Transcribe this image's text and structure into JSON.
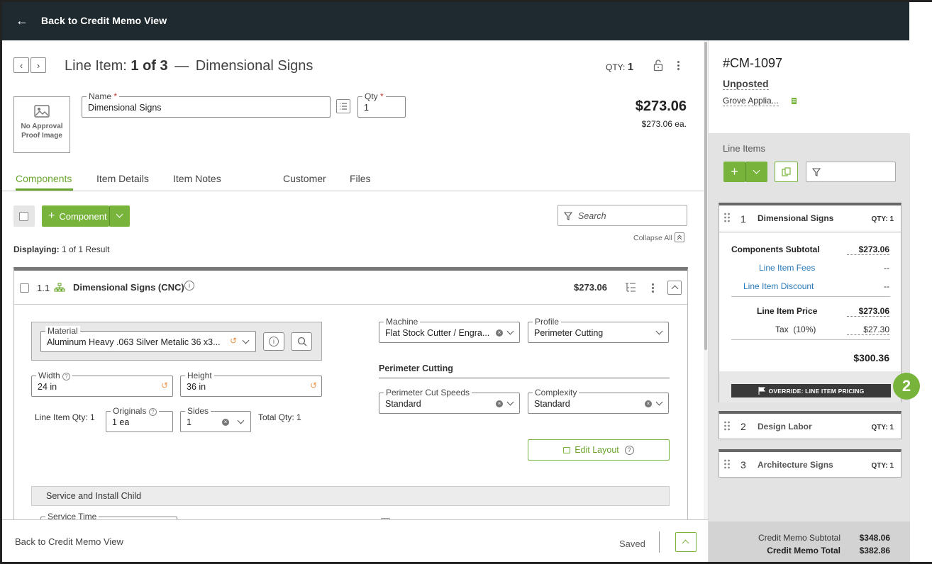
{
  "header": {
    "back_label": "Back to Credit Memo View"
  },
  "line_item": {
    "label": "Line Item:",
    "position": "1 of 3",
    "dash": "—",
    "name": "Dimensional Signs",
    "qty_label": "QTY:",
    "qty_value": "1",
    "price": "$273.06",
    "price_each": "$273.06 ea.",
    "image_placeholder": "No Approval Proof Image"
  },
  "fields": {
    "name_label": "Name",
    "name_value": "Dimensional Signs",
    "qty_label": "Qty",
    "qty_value": "1",
    "required_mark": "*"
  },
  "tabs": [
    "Components",
    "Item Details",
    "Item Notes",
    "Customer",
    "Files"
  ],
  "toolbar": {
    "add_component": "Component",
    "search_placeholder": "Search",
    "collapse_all": "Collapse All",
    "displaying_label": "Displaying:",
    "displaying_value": "1 of 1 Result"
  },
  "component": {
    "number": "1.1",
    "name": "Dimensional Signs (CNC)",
    "price": "$273.06",
    "material_label": "Material",
    "material_value": "Aluminum Heavy .063 Silver Metalic 36 x3...",
    "machine_label": "Machine",
    "machine_value": "Flat Stock Cutter / Engra...",
    "profile_label": "Profile",
    "profile_value": "Perimeter Cutting",
    "width_label": "Width",
    "width_value": "24 in",
    "height_label": "Height",
    "height_value": "36 in",
    "section_perimeter": "Perimeter Cutting",
    "cut_speeds_label": "Perimeter Cut Speeds",
    "cut_speeds_value": "Standard",
    "complexity_label": "Complexity",
    "complexity_value": "Standard",
    "line_item_qty": "Line Item Qty: 1",
    "originals_label": "Originals",
    "originals_value": "1 ea",
    "sides_label": "Sides",
    "sides_value": "1",
    "total_qty": "Total Qty: 1",
    "edit_layout": "Edit Layout",
    "service_section": "Service and Install Child",
    "service_time_label": "Service Time"
  },
  "footer": {
    "back_label": "Back to Credit Memo View",
    "status": "Saved"
  },
  "memo": {
    "number": "#CM-1097",
    "status": "Unposted",
    "customer": "Grove Applia...",
    "line_items_title": "Line Items",
    "items": [
      {
        "num": "1",
        "name": "Dimensional Signs",
        "qty": "QTY: 1"
      },
      {
        "num": "2",
        "name": "Design Labor",
        "qty": "QTY: 1"
      },
      {
        "num": "3",
        "name": "Architecture Signs",
        "qty": "QTY: 1"
      }
    ],
    "summary": {
      "components_subtotal_label": "Components Subtotal",
      "components_subtotal": "$273.06",
      "fees_label": "Line Item Fees",
      "fees": "--",
      "discount_label": "Line Item Discount",
      "discount": "--",
      "price_label": "Line Item Price",
      "price": "$273.06",
      "tax_label": "Tax",
      "tax_rate": "(10%)",
      "tax": "$27.30",
      "total": "$300.36",
      "override": "OVERRIDE: LINE ITEM PRICING"
    },
    "subtotal_label": "Credit Memo Subtotal",
    "subtotal": "$348.06",
    "total_label": "Credit Memo Total",
    "total": "$382.86"
  },
  "step_badge": "2",
  "colors": {
    "accent": "#78b33b",
    "header": "#1f2a30",
    "link": "#2a7ab8"
  }
}
